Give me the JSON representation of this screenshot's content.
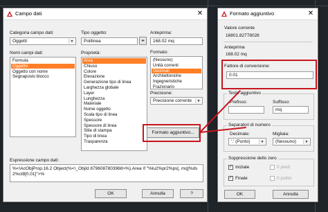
{
  "left_dialog": {
    "title": "Campo dati",
    "close": "✕",
    "category_label": "Categoria campo dati:",
    "category_value": "Oggetti",
    "field_names_label": "Nomi campi dati:",
    "field_names": [
      "Formula",
      "Oggetto",
      "Oggetto con nome",
      "Segnaposto blocco"
    ],
    "field_names_selected": 1,
    "object_type_label": "Tipo oggetto:",
    "object_type_value": "Polilinea",
    "properties_label": "Proprietà:",
    "properties": [
      "Area",
      "Chiuso",
      "Colore",
      "Elevazione",
      "Generazione tipo di linea",
      "Larghezza globale",
      "Layer",
      "Lunghezza",
      "Materiale",
      "Nome oggetto",
      "Scala tipo di linea",
      "Spessore",
      "Spessore di linea",
      "Stile di stampa",
      "Tipo di linea",
      "Trasparenza"
    ],
    "properties_selected": 0,
    "preview_label": "Anteprima:",
    "preview_value": "168.02 mq",
    "format_label": "Formato:",
    "formats": [
      "(Nessuno)",
      "Unità correnti",
      "Decimali",
      "Architettoniche",
      "Ingegneristiche",
      "Frazionario"
    ],
    "formats_selected": 2,
    "precision_label": "Precisione:",
    "precision_value": "Precisione corrente",
    "additional_format_button": "Formato aggiuntivo...",
    "expression_label": "Espressione campo dati:",
    "expression_value": "%<\\AcObjProp.16.2 Object(%<\\_ObjId 8796087803968>%).Area \\f \"%lu2%pr2%ps[, mq]%ds2%ct8[0.01]\">%",
    "ok": "OK",
    "cancel": "Annulla",
    "help": "?"
  },
  "right_dialog": {
    "title": "Formato aggiuntivo",
    "close": "✕",
    "current_value_label": "Valore corrente",
    "current_value": "16801.82778026",
    "preview_label": "Anteprima",
    "preview_value": "168.02 mq",
    "conversion_factor_label": "Fattore di conversione:",
    "conversion_factor_value": "0.01",
    "additional_text_label": "Testo aggiuntivo",
    "prefix_label": "Prefisso:",
    "prefix_value": "",
    "suffix_label": "Suffisso:",
    "suffix_value": " mq",
    "number_separators_label": "Separatori di numero",
    "decimal_label": "Decimale:",
    "decimal_value": "'.' (Punto)",
    "thousands_label": "Migliaia:",
    "thousands_value": "(Nessuno)",
    "zero_suppression_label": "Soppressione dello zero",
    "initial_label": "Iniziale",
    "initial_checked": true,
    "final_label": "Finale",
    "final_checked": true,
    "feet_label": "0 piedi",
    "inches_label": "0 pollici",
    "ok": "OK",
    "cancel": "Annulla"
  },
  "colors": {
    "selection": "#ff7f27",
    "annotation": "#c8141c"
  }
}
